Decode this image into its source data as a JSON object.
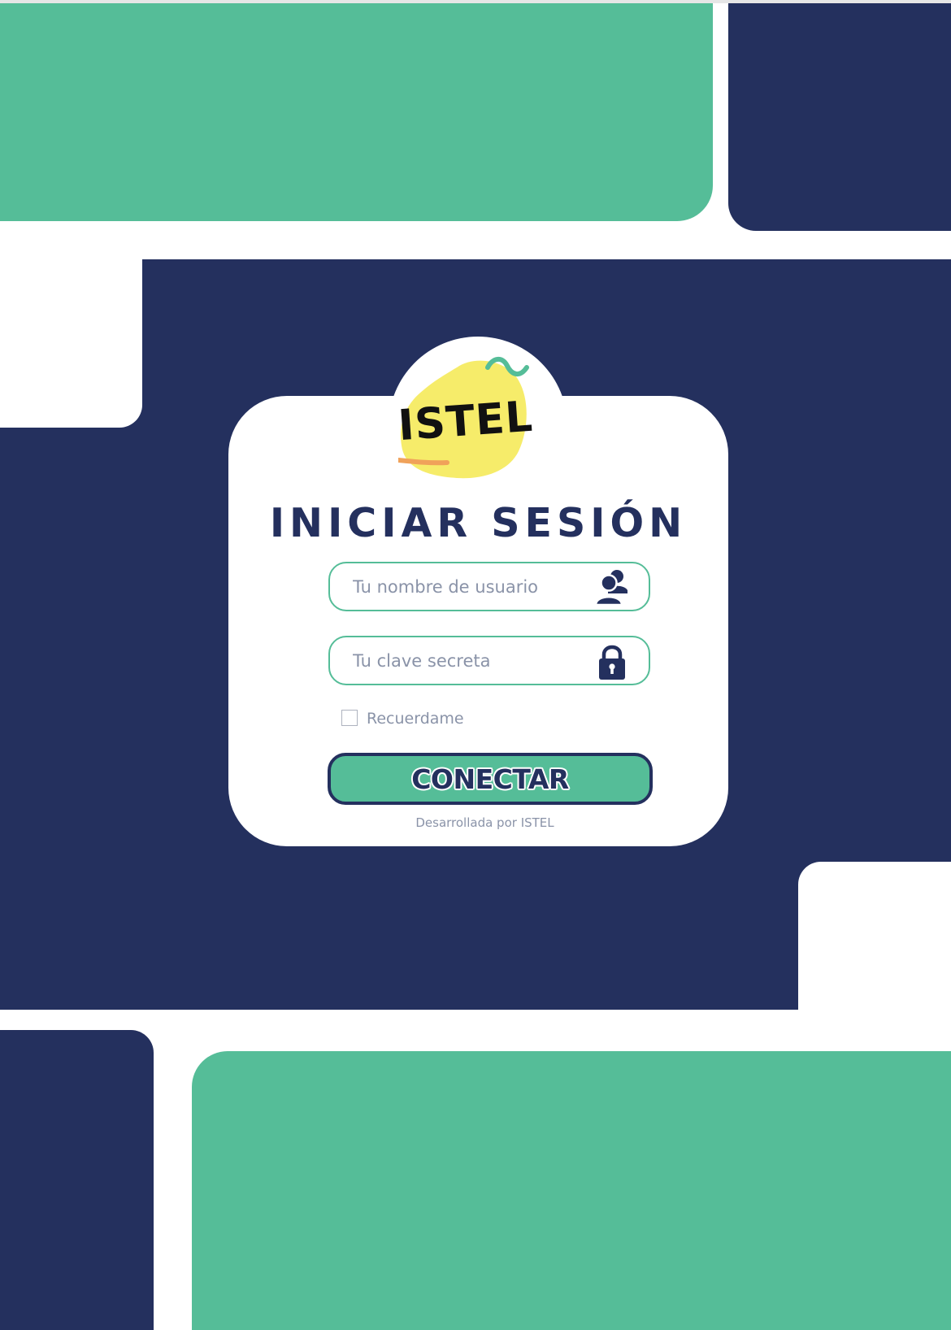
{
  "brand": {
    "logo_text": "ISTEL",
    "colors": {
      "navy": "#24305e",
      "teal": "#55bd98",
      "yellow": "#f6ec6a",
      "orange": "#f0a25a"
    }
  },
  "login": {
    "title": "INICIAR SESIÓN",
    "username": {
      "placeholder": "Tu nombre de usuario",
      "value": "",
      "icon": "user-group-icon"
    },
    "password": {
      "placeholder": "Tu clave secreta",
      "value": "",
      "icon": "lock-icon"
    },
    "remember": {
      "label": "Recuerdame",
      "checked": false
    },
    "submit_label": "CONECTAR",
    "footer_text": "Desarrollada por ISTEL"
  }
}
